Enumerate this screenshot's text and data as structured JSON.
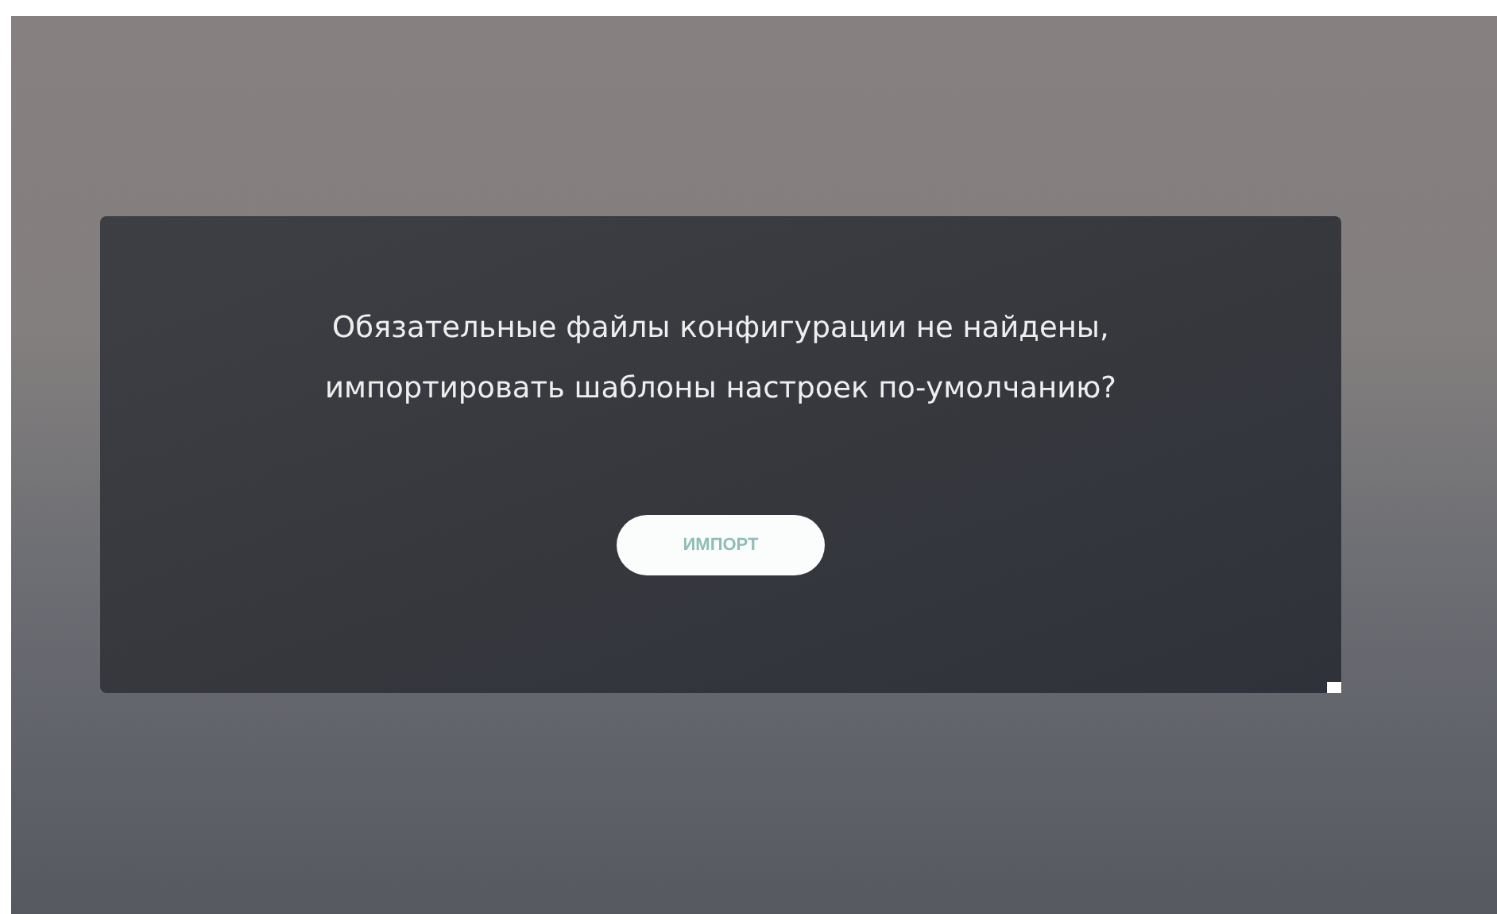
{
  "dialog": {
    "message_lines": [
      "Обязательные файлы конфигурации не найдены,",
      "импортировать шаблоны настроек по-умолчанию?"
    ],
    "button": "ИМПОРТ"
  }
}
